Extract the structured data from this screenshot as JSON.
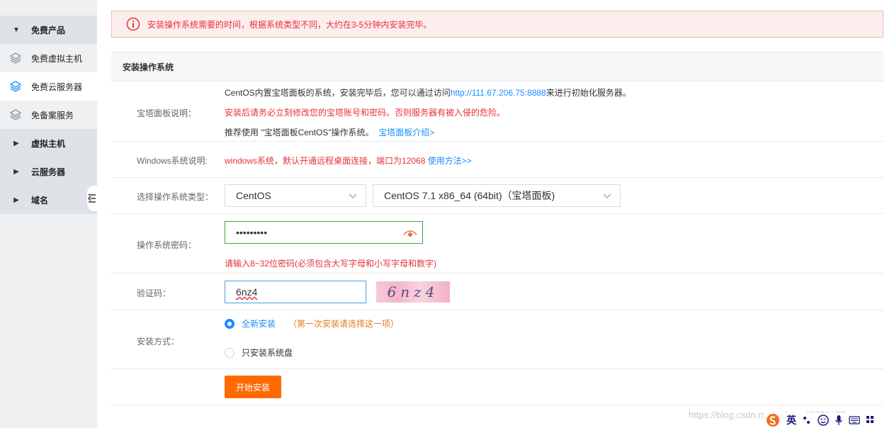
{
  "sidebar": {
    "items": [
      {
        "label": "免费产品",
        "type": "group",
        "icon": "caret-down-icon"
      },
      {
        "label": "免费虚拟主机",
        "type": "sub",
        "icon": "layers-icon"
      },
      {
        "label": "免费云服务器",
        "type": "sub",
        "icon": "layers-icon",
        "active": true
      },
      {
        "label": "免备案服务",
        "type": "sub",
        "icon": "layers-icon"
      },
      {
        "label": "虚拟主机",
        "type": "group",
        "icon": "caret-right-icon"
      },
      {
        "label": "云服务器",
        "type": "group",
        "icon": "caret-right-icon"
      },
      {
        "label": "域名",
        "type": "group",
        "icon": "caret-right-icon"
      }
    ]
  },
  "alert": {
    "text": "安装操作系统需要的时间，根据系统类型不同，大约在3-5分钟内安装完毕。"
  },
  "section": {
    "title": "安装操作系统"
  },
  "panel_desc": {
    "label": "宝塔面板说明：",
    "line1_prefix": "CentOS内置宝塔面板的系统，安装完毕后，您可以通过访问",
    "line1_link": "http://111.67.206.75:8888",
    "line1_suffix": "来进行初始化服务器。",
    "line2": "安装后请务必立刻修改您的宝塔账号和密码。否则服务器有被入侵的危险。",
    "line3_prefix": "推荐使用 \"宝塔面板CentOS\"操作系统。",
    "line3_link": "宝塔面板介绍>"
  },
  "windows_desc": {
    "label": "Windows系统说明:",
    "text": "windows系统，默认开通远程桌面连接，端口为12068",
    "link": "使用方法>>"
  },
  "os_type": {
    "label": "选择操作系统类型：",
    "family": "CentOS",
    "version": "CentOS 7.1 x86_64 (64bit)（宝塔面板)"
  },
  "password": {
    "label": "操作系统密码：",
    "value": "•••••••••",
    "hint": "请输入8~32位密码(必须包含大写字母和小写字母和数字)"
  },
  "captcha": {
    "label": "验证码：",
    "value": "6nz4",
    "image_text": "6nz4"
  },
  "install_mode": {
    "label": "安装方式：",
    "option1": "全新安装",
    "option1_note": "（第一次安装请选择这一项）",
    "option2": "只安装系统盘"
  },
  "submit": {
    "label": "开始安装"
  },
  "watermark": {
    "text": "https://blog.csdn.net/weixin_43779477"
  },
  "ime": {
    "lang": "英"
  },
  "colors": {
    "accent_orange": "#ff6a00",
    "link_blue": "#1a8cff",
    "warning_red": "#e5323e",
    "input_focus_green": "#3fa344"
  }
}
